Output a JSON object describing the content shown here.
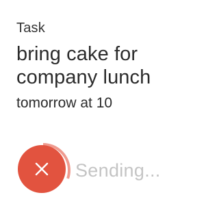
{
  "card": {
    "type_label": "Task",
    "title": "bring cake for company lunch",
    "when": "tomorrow at 10"
  },
  "action": {
    "cancel_icon": "close-icon",
    "status_text": "Sending...",
    "progress": 0.3,
    "accent_color": "#e2533f",
    "ring_color": "#ef9a8e"
  }
}
